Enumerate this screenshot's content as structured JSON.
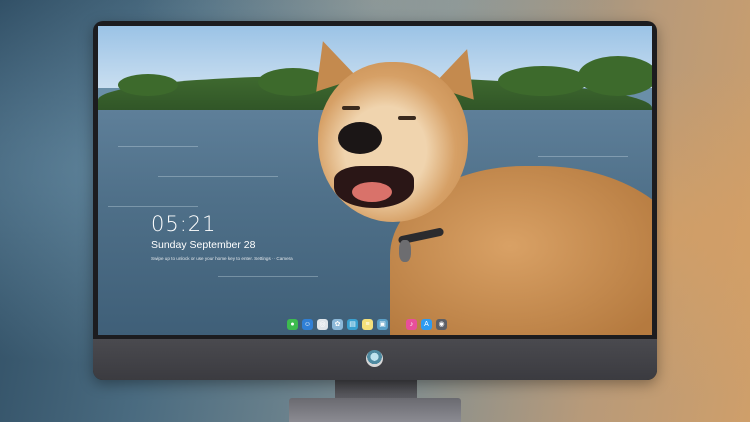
{
  "lockscreen": {
    "time": "05:21",
    "date": "Sunday September  28",
    "hint": "Swipe up to unlock or use your home key to enter. Settings ·· Camera"
  },
  "dock": {
    "icons": [
      {
        "name": "messages-icon",
        "glyph": "●",
        "color": "#3dbb4f"
      },
      {
        "name": "finder-icon",
        "glyph": "☺",
        "color": "#2f7fd6"
      },
      {
        "name": "safari-icon",
        "glyph": "◎",
        "color": "#dfe5ea"
      },
      {
        "name": "photos-icon",
        "glyph": "✿",
        "color": "#8bb8d9"
      },
      {
        "name": "clapper-icon",
        "glyph": "▤",
        "color": "#3aa0d0"
      },
      {
        "name": "notes-icon",
        "glyph": "≡",
        "color": "#f4e07a"
      },
      {
        "name": "preview-icon",
        "glyph": "▣",
        "color": "#5aa0c8"
      },
      {
        "name": "music-icon",
        "glyph": "♪",
        "color": "#e84f9a"
      },
      {
        "name": "app-store-icon",
        "glyph": "A",
        "color": "#2e9bf0"
      },
      {
        "name": "camera-icon",
        "glyph": "◉",
        "color": "#5c5f66"
      }
    ]
  }
}
